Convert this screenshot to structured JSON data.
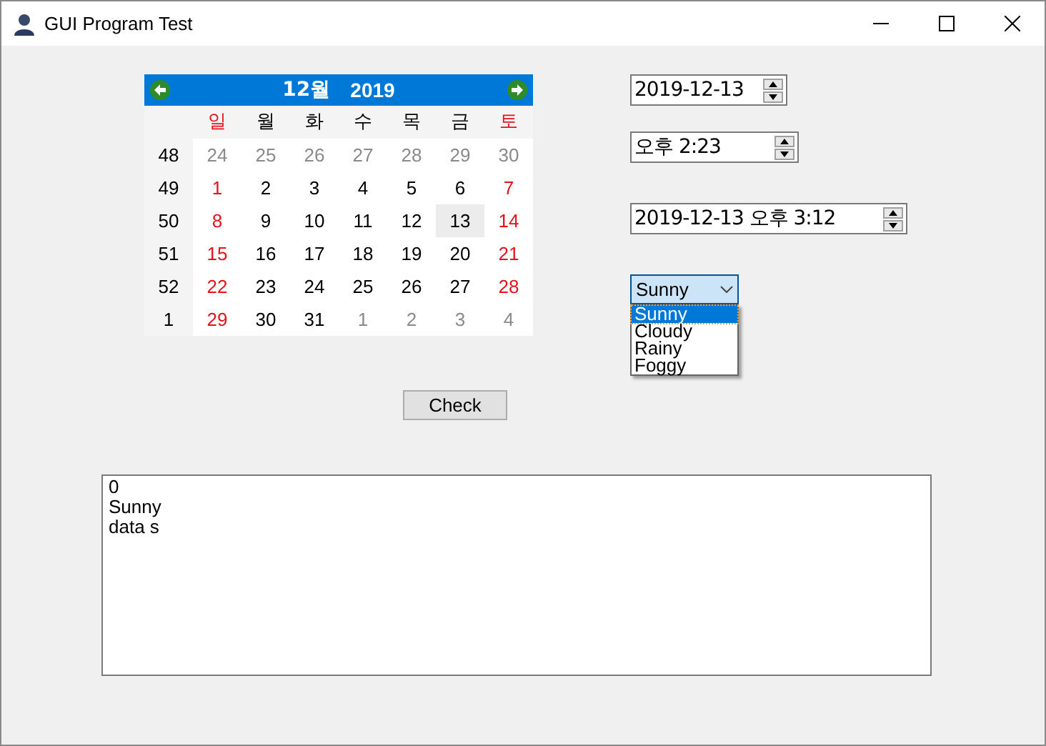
{
  "window": {
    "title": "GUI Program Test"
  },
  "calendar": {
    "month": "12월",
    "year": "2019",
    "weekdays": [
      {
        "label": "일",
        "kind": "weekend"
      },
      {
        "label": "월",
        "kind": "weekday"
      },
      {
        "label": "화",
        "kind": "weekday"
      },
      {
        "label": "수",
        "kind": "weekday"
      },
      {
        "label": "목",
        "kind": "weekday"
      },
      {
        "label": "금",
        "kind": "weekday"
      },
      {
        "label": "토",
        "kind": "weekend"
      }
    ],
    "weeks": [
      {
        "number": "48",
        "days": [
          {
            "label": "24",
            "kind": "adjacent",
            "selected": false
          },
          {
            "label": "25",
            "kind": "adjacent",
            "selected": false
          },
          {
            "label": "26",
            "kind": "adjacent",
            "selected": false
          },
          {
            "label": "27",
            "kind": "adjacent",
            "selected": false
          },
          {
            "label": "28",
            "kind": "adjacent",
            "selected": false
          },
          {
            "label": "29",
            "kind": "adjacent",
            "selected": false
          },
          {
            "label": "30",
            "kind": "adjacent",
            "selected": false
          }
        ]
      },
      {
        "number": "49",
        "days": [
          {
            "label": "1",
            "kind": "weekend",
            "selected": false
          },
          {
            "label": "2",
            "kind": "normal",
            "selected": false
          },
          {
            "label": "3",
            "kind": "normal",
            "selected": false
          },
          {
            "label": "4",
            "kind": "normal",
            "selected": false
          },
          {
            "label": "5",
            "kind": "normal",
            "selected": false
          },
          {
            "label": "6",
            "kind": "normal",
            "selected": false
          },
          {
            "label": "7",
            "kind": "weekend",
            "selected": false
          }
        ]
      },
      {
        "number": "50",
        "days": [
          {
            "label": "8",
            "kind": "weekend",
            "selected": false
          },
          {
            "label": "9",
            "kind": "normal",
            "selected": false
          },
          {
            "label": "10",
            "kind": "normal",
            "selected": false
          },
          {
            "label": "11",
            "kind": "normal",
            "selected": false
          },
          {
            "label": "12",
            "kind": "normal",
            "selected": false
          },
          {
            "label": "13",
            "kind": "normal",
            "selected": true
          },
          {
            "label": "14",
            "kind": "weekend",
            "selected": false
          }
        ]
      },
      {
        "number": "51",
        "days": [
          {
            "label": "15",
            "kind": "weekend",
            "selected": false
          },
          {
            "label": "16",
            "kind": "normal",
            "selected": false
          },
          {
            "label": "17",
            "kind": "normal",
            "selected": false
          },
          {
            "label": "18",
            "kind": "normal",
            "selected": false
          },
          {
            "label": "19",
            "kind": "normal",
            "selected": false
          },
          {
            "label": "20",
            "kind": "normal",
            "selected": false
          },
          {
            "label": "21",
            "kind": "weekend",
            "selected": false
          }
        ]
      },
      {
        "number": "52",
        "days": [
          {
            "label": "22",
            "kind": "weekend",
            "selected": false
          },
          {
            "label": "23",
            "kind": "normal",
            "selected": false
          },
          {
            "label": "24",
            "kind": "normal",
            "selected": false
          },
          {
            "label": "25",
            "kind": "normal",
            "selected": false
          },
          {
            "label": "26",
            "kind": "normal",
            "selected": false
          },
          {
            "label": "27",
            "kind": "normal",
            "selected": false
          },
          {
            "label": "28",
            "kind": "weekend",
            "selected": false
          }
        ]
      },
      {
        "number": "1",
        "days": [
          {
            "label": "29",
            "kind": "weekend",
            "selected": false
          },
          {
            "label": "30",
            "kind": "normal",
            "selected": false
          },
          {
            "label": "31",
            "kind": "normal",
            "selected": false
          },
          {
            "label": "1",
            "kind": "adjacent",
            "selected": false
          },
          {
            "label": "2",
            "kind": "adjacent",
            "selected": false
          },
          {
            "label": "3",
            "kind": "adjacent",
            "selected": false
          },
          {
            "label": "4",
            "kind": "adjacent",
            "selected": false
          }
        ]
      }
    ]
  },
  "date_picker": {
    "value": "2019-12-13"
  },
  "time_picker": {
    "value": "오후 2:23"
  },
  "datetime_picker": {
    "value": "2019-12-13 오후 3:12"
  },
  "combo": {
    "value": "Sunny",
    "expanded": true,
    "options": [
      {
        "label": "Sunny",
        "selected": true
      },
      {
        "label": "Cloudy",
        "selected": false
      },
      {
        "label": "Rainy",
        "selected": false
      },
      {
        "label": "Foggy",
        "selected": false
      }
    ]
  },
  "check_button": {
    "label": "Check"
  },
  "output": {
    "lines": [
      "0",
      "Sunny",
      "data s"
    ]
  }
}
